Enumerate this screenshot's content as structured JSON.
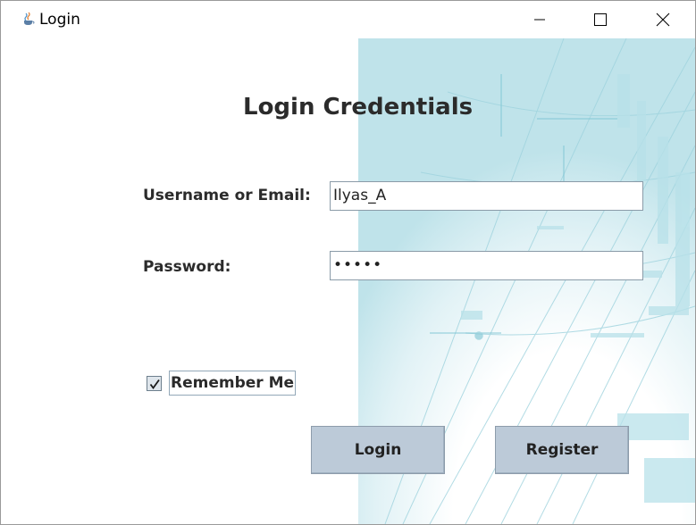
{
  "window": {
    "title": "Login",
    "app_icon": "java-cup-icon",
    "controls": {
      "minimize_icon": "minimize-icon",
      "maximize_icon": "maximize-icon",
      "close_icon": "close-icon"
    }
  },
  "form": {
    "heading": "Login Credentials",
    "username": {
      "label": "Username or Email:",
      "value": "Ilyas_A"
    },
    "password": {
      "label": "Password:",
      "value": "•••••"
    },
    "remember_me": {
      "label": "Remember Me",
      "checked": true
    },
    "buttons": {
      "login": "Login",
      "register": "Register"
    }
  },
  "colors": {
    "button_bg": "#bccad8",
    "field_border": "#8a9ba8",
    "text": "#2b2b2b"
  }
}
